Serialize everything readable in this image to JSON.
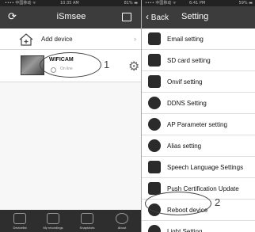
{
  "left_screen": {
    "status": {
      "carrier": "•••• 中国移动 ᯤ",
      "time": "10:35 AM",
      "battery": "81% ▬"
    },
    "nav": {
      "title": "iSmsee"
    },
    "add_device": {
      "label": "Add device"
    },
    "device": {
      "name": "WIFICAM",
      "state": "On line"
    },
    "callout_number": "1",
    "tabs": [
      {
        "label": "Devicelist",
        "icon": "camera-icon"
      },
      {
        "label": "My recordings",
        "icon": "folder-icon"
      },
      {
        "label": "Snapshots",
        "icon": "picture-icon"
      },
      {
        "label": "About",
        "icon": "info-icon"
      }
    ]
  },
  "right_screen": {
    "status": {
      "carrier": "•••• 中国移动 ᯤ",
      "time": "6:41 PM",
      "battery": "59% ▬"
    },
    "nav": {
      "back_label": "Back",
      "title": "Setting"
    },
    "items": [
      {
        "label": "Email setting",
        "icon": "email-icon"
      },
      {
        "label": "SD card setting",
        "icon": "sd-card-icon"
      },
      {
        "label": "Onvif setting",
        "icon": "onvif-icon"
      },
      {
        "label": "DDNS Setting",
        "icon": "ddns-icon"
      },
      {
        "label": "AP Parameter setting",
        "icon": "ap-icon"
      },
      {
        "label": "Alias setting",
        "icon": "alias-icon"
      },
      {
        "label": "Speech Language Settings",
        "icon": "speech-icon"
      },
      {
        "label": "Push Certification Update",
        "icon": "push-icon"
      },
      {
        "label": "Reboot device",
        "icon": "reboot-icon"
      },
      {
        "label": "Light Setting",
        "icon": "light-icon"
      }
    ],
    "callout_number": "2"
  }
}
